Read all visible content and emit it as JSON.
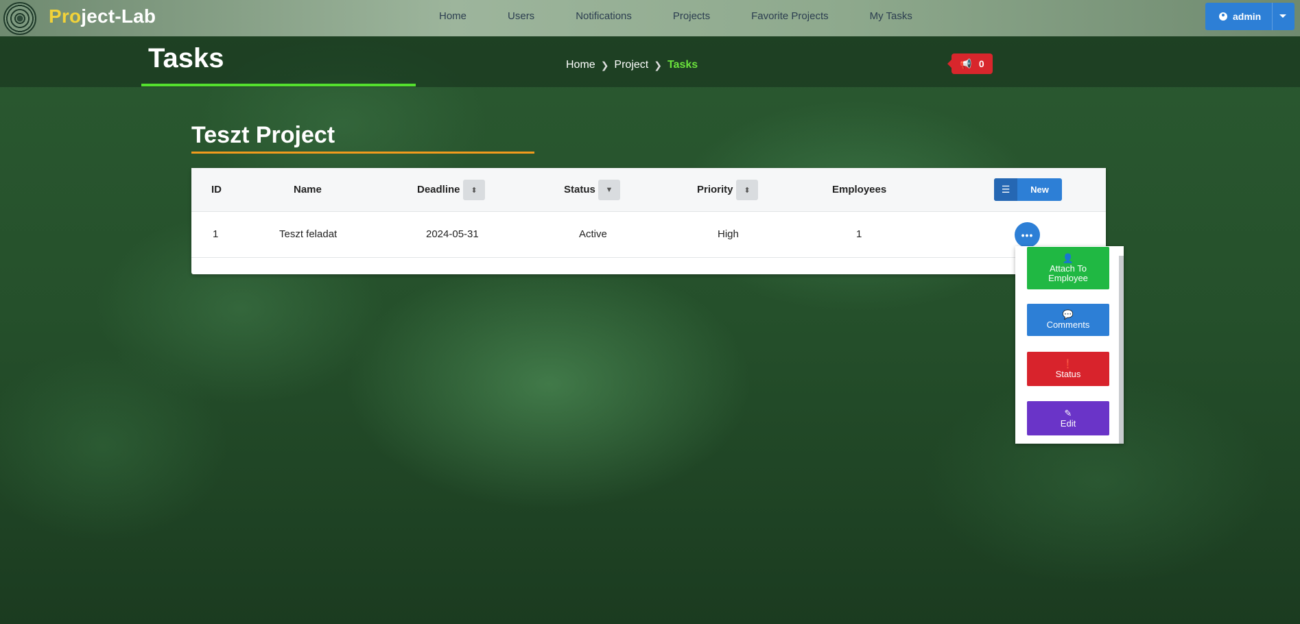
{
  "brand": {
    "prefix": "Pro",
    "suffix": "ject-Lab"
  },
  "nav": {
    "links": [
      "Home",
      "Users",
      "Notifications",
      "Projects",
      "Favorite Projects",
      "My Tasks"
    ]
  },
  "user": {
    "name": "admin"
  },
  "header": {
    "title": "Tasks",
    "breadcrumb": [
      "Home",
      "Project",
      "Tasks"
    ],
    "notification_count": "0"
  },
  "project": {
    "title": "Teszt Project"
  },
  "table": {
    "columns": [
      "ID",
      "Name",
      "Deadline",
      "Status",
      "Priority",
      "Employees"
    ],
    "new_button": "New",
    "rows": [
      {
        "id": "1",
        "name": "Teszt feladat",
        "deadline": "2024-05-31",
        "status": "Active",
        "priority": "High",
        "employees": "1"
      }
    ]
  },
  "actions": {
    "attach_line1": "Attach To",
    "attach_line2": "Employee",
    "comments": "Comments",
    "status": "Status",
    "edit": "Edit"
  },
  "colors": {
    "accent_green": "#54e02e",
    "accent_orange": "#f29b1d",
    "primary_blue": "#2d7fd6",
    "danger_red": "#d8262c",
    "success_green": "#20b843",
    "purple": "#6a34c8",
    "brand_yellow": "#f1d23a"
  }
}
